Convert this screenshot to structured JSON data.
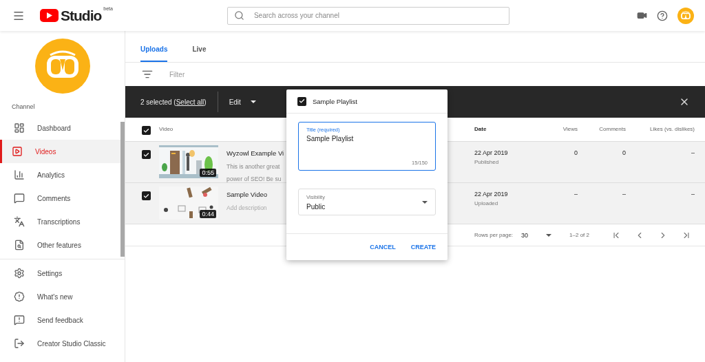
{
  "header": {
    "logo_text": "Studio",
    "logo_badge": "beta",
    "search": {
      "placeholder": "Search across your channel"
    }
  },
  "sidebar": {
    "section_label": "Channel",
    "nav": [
      {
        "label": "Dashboard",
        "selected": false
      },
      {
        "label": "Videos",
        "selected": true
      },
      {
        "label": "Analytics",
        "selected": false
      },
      {
        "label": "Comments",
        "selected": false
      },
      {
        "label": "Transcriptions",
        "selected": false
      },
      {
        "label": "Other features",
        "selected": false
      }
    ],
    "footer": [
      {
        "label": "Settings"
      },
      {
        "label": "What's new"
      },
      {
        "label": "Send feedback"
      },
      {
        "label": "Creator Studio Classic"
      }
    ]
  },
  "tabs": [
    {
      "label": "Uploads",
      "selected": true
    },
    {
      "label": "Live",
      "selected": false
    }
  ],
  "filter": {
    "placeholder": "Filter"
  },
  "selection_bar": {
    "count": "2 selected (",
    "select_all": "Select all",
    "count_end": ")",
    "edit": "Edit"
  },
  "table": {
    "header_checked": true,
    "columns": [
      "Video",
      "Date",
      "Views",
      "Comments",
      "Likes (vs. dislikes)"
    ],
    "rows": [
      {
        "checked": true,
        "duration": "0:55",
        "title": "Wyzowl Example Vi",
        "description": [
          "This is another great",
          "power of SEO! Be su"
        ],
        "description_muted": false,
        "date": "22 Apr 2019",
        "status": "Published",
        "views": "0",
        "comments": "0",
        "likes": "–"
      },
      {
        "checked": true,
        "duration": "0:44",
        "title": "Sample Video",
        "description": [
          "Add description"
        ],
        "description_muted": true,
        "date": "22 Apr 2019",
        "status": "Uploaded",
        "views": "–",
        "comments": "–",
        "likes": "–"
      }
    ]
  },
  "pagination": {
    "rows_label": "Rows per page:",
    "rows_value": "30",
    "range": "1–2 of 2"
  },
  "dialog": {
    "playlist": {
      "label": "Sample Playlist",
      "checked": true
    },
    "title_field": {
      "label": "Title (required)",
      "value": "Sample Playlist",
      "counter": "15/150"
    },
    "visibility": {
      "label": "Visibility",
      "value": "Public"
    },
    "buttons": [
      "CANCEL",
      "CREATE"
    ]
  }
}
